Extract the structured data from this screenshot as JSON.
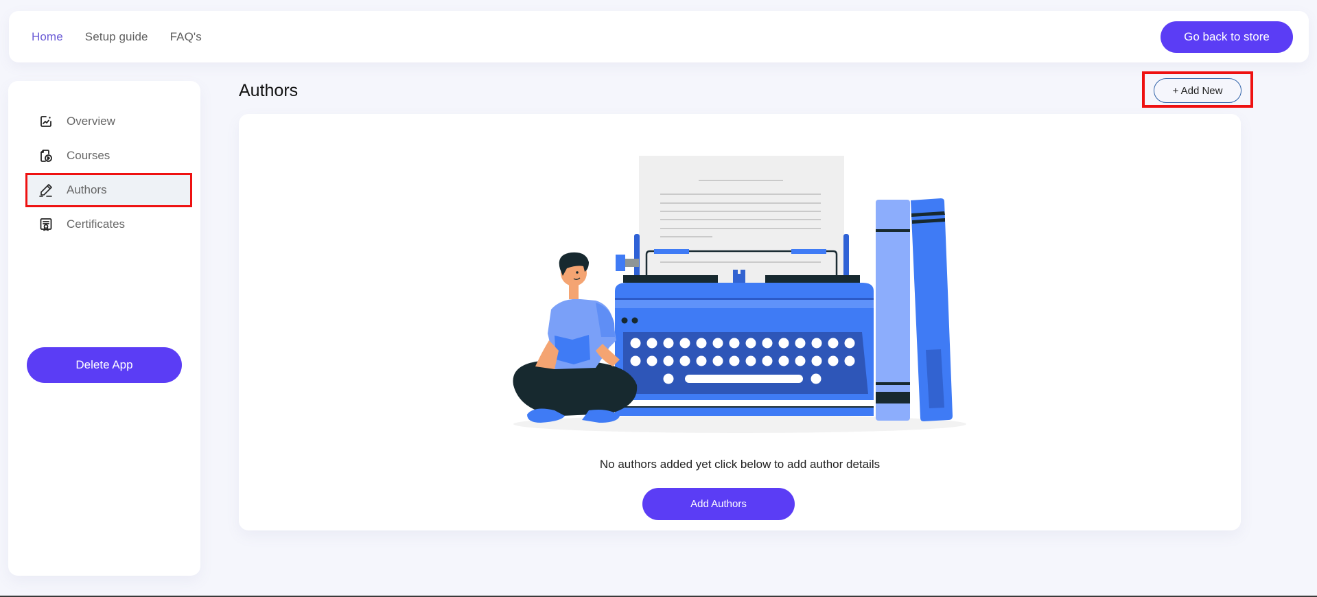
{
  "topnav": {
    "links": [
      {
        "label": "Home",
        "active": true
      },
      {
        "label": "Setup guide",
        "active": false
      },
      {
        "label": "FAQ's",
        "active": false
      }
    ],
    "store_button": "Go back to store"
  },
  "sidebar": {
    "items": [
      {
        "label": "Overview",
        "icon": "chart-edit-icon",
        "active": false
      },
      {
        "label": "Courses",
        "icon": "course-play-icon",
        "active": false
      },
      {
        "label": "Authors",
        "icon": "pencil-icon",
        "active": true
      },
      {
        "label": "Certificates",
        "icon": "certificate-icon",
        "active": false
      }
    ],
    "delete_button": "Delete App"
  },
  "main": {
    "title": "Authors",
    "add_new_button": "+ Add New",
    "empty_state": {
      "message": "No authors added yet click below to add author details",
      "button": "Add Authors"
    }
  },
  "colors": {
    "accent": "#5b3df5",
    "active_link": "#6a5bd6",
    "highlight_box": "#ee1111",
    "background": "#f5f6fc"
  }
}
